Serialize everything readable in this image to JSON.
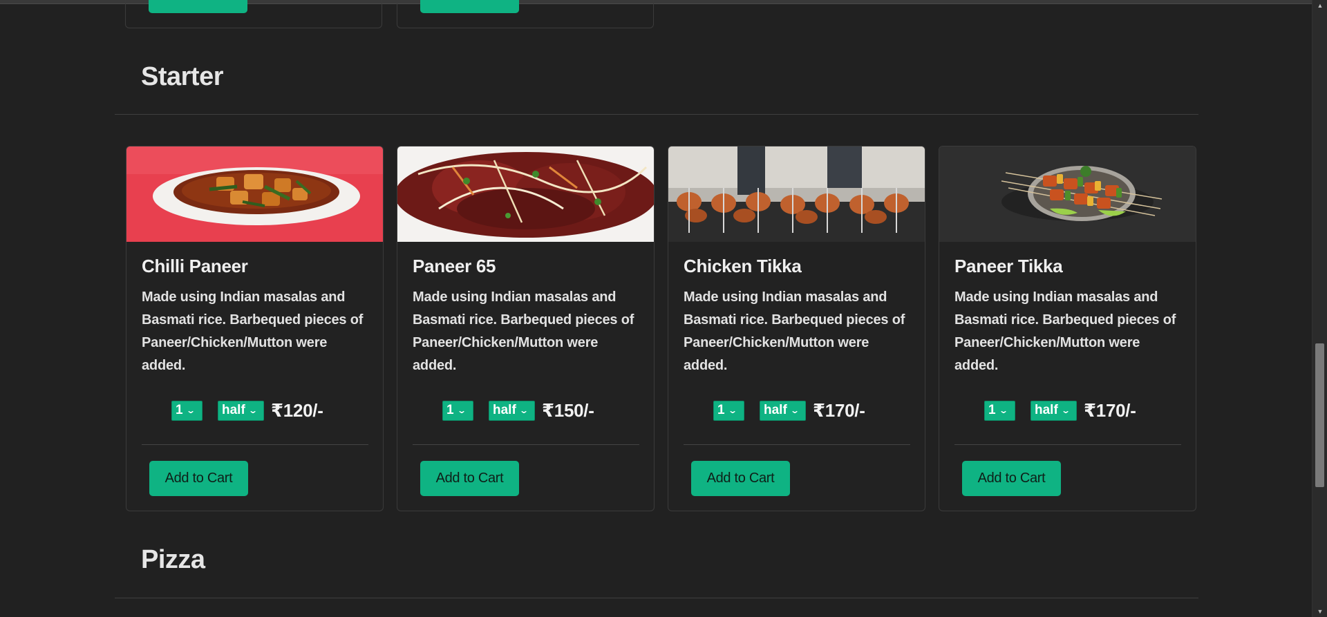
{
  "sections": [
    {
      "title": "Starter"
    },
    {
      "title": "Pizza"
    }
  ],
  "cards": [
    {
      "title": "Chilli Paneer",
      "description": "Made using Indian masalas and Basmati rice. Barbequed pieces of Paneer/Chicken/Mutton were added.",
      "qty": "1",
      "size": "half",
      "price": "₹120/-",
      "button": "Add to Cart",
      "image": "chilli-paneer-photo"
    },
    {
      "title": "Paneer 65",
      "description": "Made using Indian masalas and Basmati rice. Barbequed pieces of Paneer/Chicken/Mutton were added.",
      "qty": "1",
      "size": "half",
      "price": "₹150/-",
      "button": "Add to Cart",
      "image": "paneer-65-photo"
    },
    {
      "title": "Chicken Tikka",
      "description": "Made using Indian masalas and Basmati rice. Barbequed pieces of Paneer/Chicken/Mutton were added.",
      "qty": "1",
      "size": "half",
      "price": "₹170/-",
      "button": "Add to Cart",
      "image": "chicken-tikka-photo"
    },
    {
      "title": "Paneer Tikka",
      "description": "Made using Indian masalas and Basmati rice. Barbequed pieces of Paneer/Chicken/Mutton were added.",
      "qty": "1",
      "size": "half",
      "price": "₹170/-",
      "button": "Add to Cart",
      "image": "paneer-tikka-photo"
    }
  ],
  "icons": {
    "chevron": "chevron-down-icon"
  },
  "colors": {
    "accent": "#0fb383",
    "background": "#212121"
  }
}
